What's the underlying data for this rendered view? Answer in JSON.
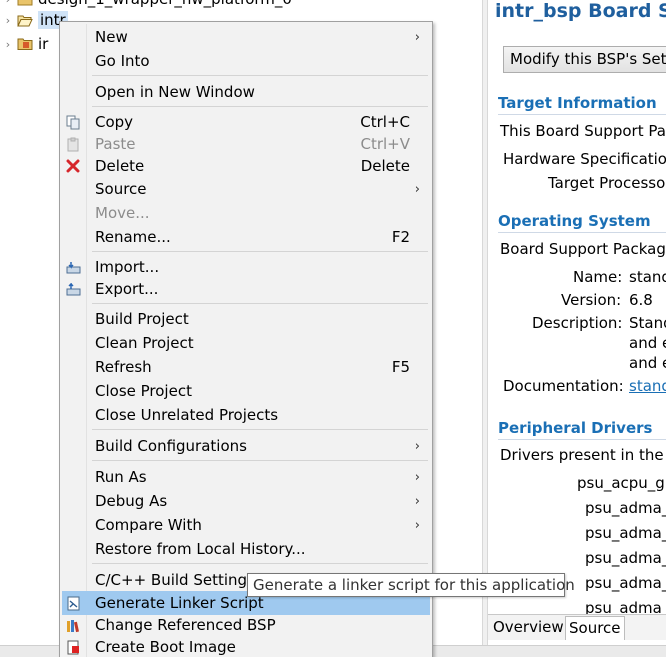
{
  "explorer": {
    "items": [
      {
        "label": "design_1_wrapper_hw_platform_0",
        "icon": "folder-icon"
      },
      {
        "label": "intr",
        "icon": "open-folder-icon"
      },
      {
        "label": "ir",
        "icon": "bsp-project-icon"
      }
    ]
  },
  "editor": {
    "title": "intr_bsp Board Sup",
    "modify_button": "Modify this BSP's Setti",
    "target_info": {
      "heading": "Target Information",
      "line": "This Board Support Pac",
      "hw_spec": "Hardware Specification",
      "target_proc": "Target Processo"
    },
    "os": {
      "heading": "Operating System",
      "line": "Board Support Package",
      "name_label": "Name:",
      "name_value": "stand",
      "version_label": "Version:",
      "version_value": "6.8",
      "desc_label": "Description:",
      "desc_value_1": "Stand",
      "desc_value_2": "and e",
      "desc_value_3": "and e",
      "doc_label": "Documentation:",
      "doc_value": "stand"
    },
    "drivers": {
      "heading": "Peripheral Drivers",
      "line": "Drivers present in the B",
      "list": [
        "psu_acpu_gi",
        "psu_adma_",
        "psu_adma_",
        "psu_adma_",
        "psu_adma_",
        "psu_adma_"
      ]
    },
    "tabs": {
      "overview": "Overview",
      "source": "Source"
    }
  },
  "menu": {
    "new": {
      "label": "New"
    },
    "go_into": {
      "label": "Go Into"
    },
    "open_new_window": {
      "label": "Open in New Window"
    },
    "copy": {
      "label": "Copy",
      "shortcut": "Ctrl+C"
    },
    "paste": {
      "label": "Paste",
      "shortcut": "Ctrl+V"
    },
    "delete": {
      "label": "Delete",
      "shortcut": "Delete"
    },
    "source": {
      "label": "Source"
    },
    "move": {
      "label": "Move..."
    },
    "rename": {
      "label": "Rename...",
      "shortcut": "F2"
    },
    "import": {
      "label": "Import..."
    },
    "export": {
      "label": "Export..."
    },
    "build_project": {
      "label": "Build Project"
    },
    "clean_project": {
      "label": "Clean Project"
    },
    "refresh": {
      "label": "Refresh",
      "shortcut": "F5"
    },
    "close_project": {
      "label": "Close Project"
    },
    "close_unrelated": {
      "label": "Close Unrelated Projects"
    },
    "build_configs": {
      "label": "Build Configurations"
    },
    "run_as": {
      "label": "Run As"
    },
    "debug_as": {
      "label": "Debug As"
    },
    "compare_with": {
      "label": "Compare With"
    },
    "restore_history": {
      "label": "Restore from Local History..."
    },
    "cpp_build_settings": {
      "label": "C/C++ Build Settings"
    },
    "gen_linker": {
      "label": "Generate Linker Script"
    },
    "change_bsp": {
      "label": "Change Referenced BSP"
    },
    "create_boot": {
      "label": "Create Boot Image"
    }
  },
  "tooltip": {
    "text": "Generate a linker script for this application"
  },
  "colors": {
    "hover": "#9fc9ef",
    "heading": "#1a6fb5",
    "menu_bg": "#f2f2f2"
  }
}
